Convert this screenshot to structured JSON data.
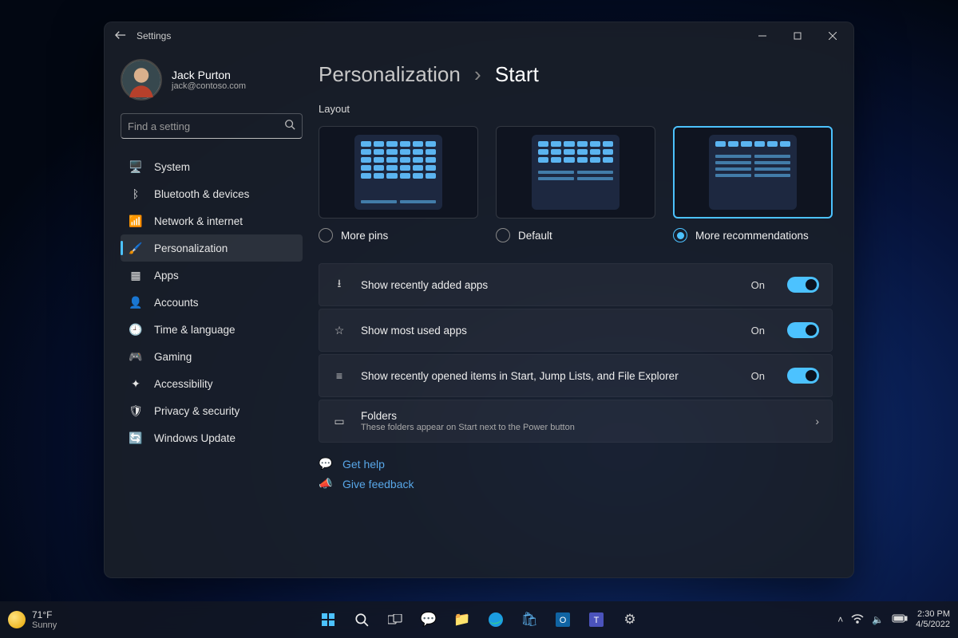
{
  "window": {
    "title": "Settings"
  },
  "user": {
    "name": "Jack Purton",
    "email": "jack@contoso.com"
  },
  "search": {
    "placeholder": "Find a setting"
  },
  "nav": [
    {
      "icon": "🖥️",
      "label": "System"
    },
    {
      "icon": "ᛒ",
      "label": "Bluetooth & devices"
    },
    {
      "icon": "📶",
      "label": "Network & internet"
    },
    {
      "icon": "🖌️",
      "label": "Personalization",
      "active": true
    },
    {
      "icon": "▦",
      "label": "Apps"
    },
    {
      "icon": "👤",
      "label": "Accounts"
    },
    {
      "icon": "🕘",
      "label": "Time & language"
    },
    {
      "icon": "🎮",
      "label": "Gaming"
    },
    {
      "icon": "✦",
      "label": "Accessibility"
    },
    {
      "icon": "🛡",
      "label": "Privacy & security"
    },
    {
      "icon": "🔄",
      "label": "Windows Update"
    }
  ],
  "breadcrumb": {
    "parent": "Personalization",
    "sep": "›",
    "current": "Start"
  },
  "layout": {
    "label": "Layout",
    "options": [
      {
        "label": "More pins",
        "selected": false
      },
      {
        "label": "Default",
        "selected": false
      },
      {
        "label": "More recommendations",
        "selected": true
      }
    ]
  },
  "settings": [
    {
      "icon": "⭳",
      "label": "Show recently added apps",
      "state": "On",
      "type": "toggle"
    },
    {
      "icon": "☆",
      "label": "Show most used apps",
      "state": "On",
      "type": "toggle"
    },
    {
      "icon": "≡",
      "label": "Show recently opened items in Start, Jump Lists, and File Explorer",
      "state": "On",
      "type": "toggle"
    },
    {
      "icon": "▭",
      "label": "Folders",
      "desc": "These folders appear on Start next to the Power button",
      "type": "nav"
    }
  ],
  "help": [
    {
      "icon": "💬",
      "label": "Get help"
    },
    {
      "icon": "📣",
      "label": "Give feedback"
    }
  ],
  "taskbar": {
    "weather": {
      "temp": "71°F",
      "cond": "Sunny"
    },
    "time": "2:30 PM",
    "date": "4/5/2022"
  }
}
